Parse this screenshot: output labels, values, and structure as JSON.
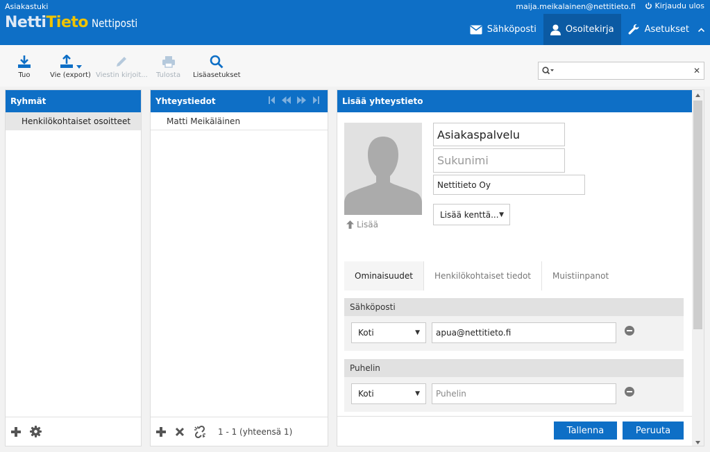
{
  "header": {
    "top_left": "Asiakastuki",
    "user_email": "maija.meikalainen@nettitieto.fi",
    "logout_label": "Kirjaudu ulos",
    "logo_part1": "Netti",
    "logo_part2": "Tieto",
    "logo_part3": "Nettiposti",
    "nav": {
      "mail": "Sähköposti",
      "addressbook": "Osoitekirja",
      "settings": "Asetukset"
    }
  },
  "toolbar": {
    "import": "Tuo",
    "export": "Vie (export)",
    "compose": "Viestin kirjoit...",
    "print": "Tulosta",
    "advanced": "Lisäasetukset"
  },
  "search": {
    "value": ""
  },
  "groups": {
    "title": "Ryhmät",
    "items": [
      "Henkilökohtaiset osoitteet"
    ]
  },
  "contacts": {
    "title": "Yhteystiedot",
    "items": [
      "Matti Meikäläinen"
    ],
    "count": "1 - 1 (yhteensä 1)"
  },
  "editor": {
    "title": "Lisää yhteystieto",
    "first_name": "Asiakaspalvelu",
    "last_name_placeholder": "Sukunimi",
    "organization": "Nettitieto Oy",
    "photo_add": "Lisää",
    "add_field": "Lisää kenttä...",
    "tabs": [
      "Ominaisuudet",
      "Henkilökohtaiset tiedot",
      "Muistiinpanot"
    ],
    "email_section": "Sähköposti",
    "email_type": "Koti",
    "email_value": "apua@nettitieto.fi",
    "phone_section": "Puhelin",
    "phone_type": "Koti",
    "phone_placeholder": "Puhelin",
    "save": "Tallenna",
    "cancel": "Peruuta"
  },
  "colors": {
    "brand": "#0e6fc6",
    "brand_dark": "#0b5aa3",
    "logo_yellow": "#f0c300"
  }
}
